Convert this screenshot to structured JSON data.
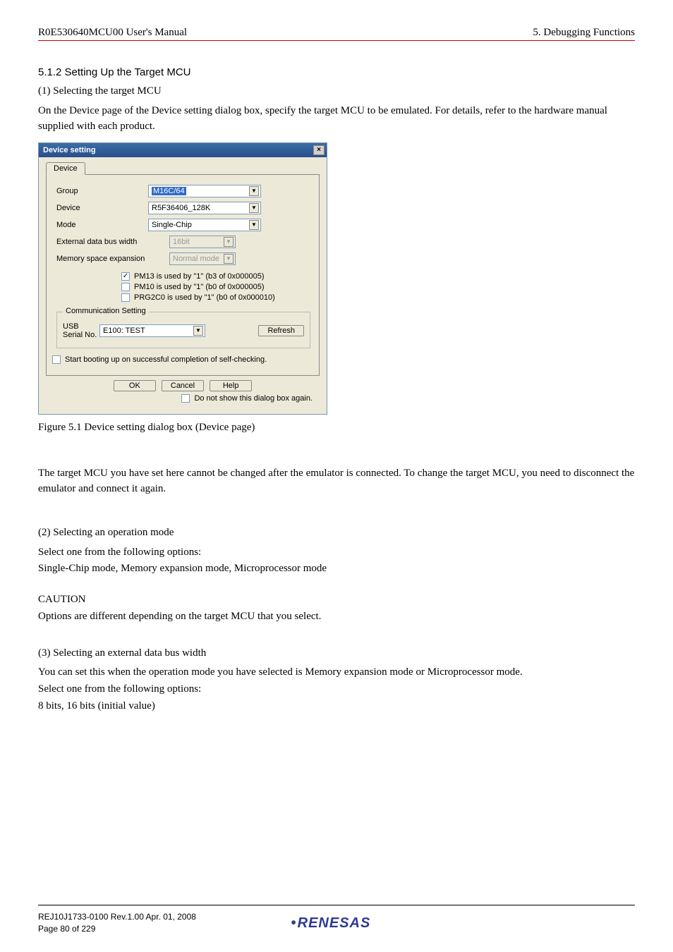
{
  "header": {
    "left": "R0E530640MCU00 User's Manual",
    "right": "5. Debugging Functions"
  },
  "section": {
    "title": "5.1.2  Setting Up the Target MCU",
    "p1_label": "(1) Selecting the target MCU",
    "p1_text": "On the Device page of the Device setting dialog box, specify the target MCU to be emulated. For details, refer to the hardware manual supplied with each product.",
    "fig_caption": "Figure 5.1 Device setting dialog box (Device page)",
    "p2_text": "The target MCU you have set here cannot be changed after the emulator is connected. To change the target MCU, you need to disconnect the emulator and connect it again.",
    "p3_label": "(2) Selecting an operation mode",
    "p3_text1": "Select one from the following options:",
    "p3_text2": "Single-Chip mode, Memory expansion mode, Microprocessor mode",
    "caution_label": "CAUTION",
    "caution_text": "Options are different depending on the target MCU that you select.",
    "p4_label": "(3) Selecting an external data bus width",
    "p4_text1": "You can set this when the operation mode you have selected is Memory expansion mode or Microprocessor mode.",
    "p4_text2": "Select one from the following options:",
    "p4_text3": "8 bits, 16 bits (initial value)"
  },
  "dialog": {
    "title": "Device setting",
    "tab": "Device",
    "labels": {
      "group": "Group",
      "device": "Device",
      "mode": "Mode",
      "ext_bus": "External data bus width",
      "mem_exp": "Memory space expansion",
      "usb_serial": "USB\nSerial No."
    },
    "values": {
      "group": "M16C/64",
      "device": "R5F36406_128K",
      "mode": "Single-Chip",
      "ext_bus": "16bit",
      "mem_exp": "Normal mode",
      "usb_serial": "E100: TEST"
    },
    "checks": {
      "pm13": "PM13 is used by \"1\" (b3 of 0x000005)",
      "pm10": "PM10 is used by \"1\" (b0 of 0x000005)",
      "prg2c0": "PRG2C0 is used by \"1\" (b0 of 0x000010)",
      "startboot": "Start booting up on successful completion of self-checking.",
      "noshow": "Do not show this dialog box again."
    },
    "group_title": "Communication Setting",
    "buttons": {
      "refresh": "Refresh",
      "ok": "OK",
      "cancel": "Cancel",
      "help": "Help"
    }
  },
  "footer": {
    "line1": "REJ10J1733-0100   Rev.1.00   Apr. 01, 2008",
    "line2": "Page 80 of 229",
    "logo": "RENESAS"
  }
}
